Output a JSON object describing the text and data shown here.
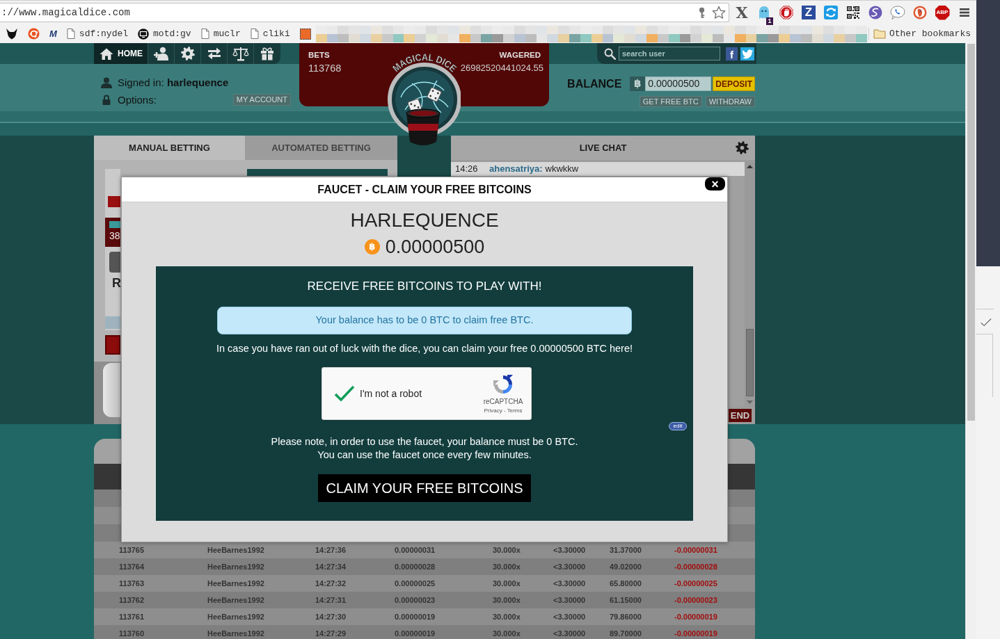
{
  "browser": {
    "address": "://www.magicaldice.com",
    "extensions": [
      {
        "kind": "letter",
        "label": "X"
      },
      {
        "kind": "ghost",
        "badge": "1"
      },
      {
        "kind": "stop"
      },
      {
        "kind": "tile",
        "label": "Z"
      },
      {
        "kind": "sync"
      },
      {
        "kind": "qr"
      },
      {
        "kind": "swirl"
      },
      {
        "kind": "phone"
      },
      {
        "kind": "duck"
      },
      {
        "kind": "octagon",
        "label": "ABP"
      }
    ],
    "bookmarks": [
      {
        "kind": "creature"
      },
      {
        "kind": "ring"
      },
      {
        "kind": "logo",
        "label": "M"
      },
      {
        "kind": "page",
        "label": "sdf:nydel"
      },
      {
        "kind": "disc",
        "label": "motd:gv"
      },
      {
        "kind": "page",
        "label": "muclr"
      },
      {
        "kind": "page",
        "label": "cliki"
      },
      {
        "kind": "square"
      }
    ],
    "other_bookmarks": "Other bookmarks"
  },
  "nav": {
    "items": [
      {
        "kind": "home",
        "label": "HOME",
        "selected": true
      },
      {
        "kind": "add-user",
        "selected": false
      },
      {
        "kind": "gear",
        "selected": false
      },
      {
        "kind": "exchange",
        "selected": false
      },
      {
        "kind": "scales",
        "selected": false
      },
      {
        "kind": "gift",
        "selected": false
      }
    ],
    "search": {
      "placeholder": "search user"
    },
    "social": [
      {
        "kind": "facebook",
        "label": "f"
      },
      {
        "kind": "twitter"
      }
    ]
  },
  "user": {
    "signed_in": "Signed in: **harlequence**",
    "options_label": "Options:",
    "account_button": "MY ACCOUNT"
  },
  "stats": {
    "bets_label": "BETS",
    "bets": "113768",
    "wagered_label": "WAGERED",
    "wagered": "26982520441024.55"
  },
  "logo": {
    "text": "MAGICAL DICE"
  },
  "balance": {
    "label": "BALANCE",
    "symbol": "฿",
    "value": "0.00000500",
    "deposit_button": "DEPOSIT",
    "buttons": [
      "GET FREE BTC",
      "WITHDRAW"
    ]
  },
  "betting_panel": {
    "tabs": [
      {
        "label": "MANUAL BETTING",
        "selected": true
      },
      {
        "label": "AUTOMATED BETTING",
        "selected": false
      }
    ],
    "box_value": "38",
    "letter": "R"
  },
  "chat": {
    "title": "LIVE CHAT",
    "messages": [
      {
        "time": "14:26",
        "user": "ahensatriya:",
        "text": "wkwkkw"
      }
    ],
    "send_button": "END"
  },
  "bets_table": {
    "rows": [
      {
        "id": "113765",
        "user": "HeeBarnes1992",
        "time": "14:27:36",
        "bet": "0.00000031",
        "payout": "30.000x",
        "target": "<3.30000",
        "roll": "31.37000",
        "profit": "-0.00000031"
      },
      {
        "id": "113764",
        "user": "HeeBarnes1992",
        "time": "14:27:34",
        "bet": "0.00000028",
        "payout": "30.000x",
        "target": "<3.30000",
        "roll": "49.02000",
        "profit": "-0.00000028"
      },
      {
        "id": "113763",
        "user": "HeeBarnes1992",
        "time": "14:27:32",
        "bet": "0.00000025",
        "payout": "30.000x",
        "target": "<3.30000",
        "roll": "65.80000",
        "profit": "-0.00000025"
      },
      {
        "id": "113762",
        "user": "HeeBarnes1992",
        "time": "14:27:31",
        "bet": "0.00000023",
        "payout": "30.000x",
        "target": "<3.30000",
        "roll": "61.15000",
        "profit": "-0.00000023"
      },
      {
        "id": "113761",
        "user": "HeeBarnes1992",
        "time": "14:27:30",
        "bet": "0.00000019",
        "payout": "30.000x",
        "target": "<3.30000",
        "roll": "79.86000",
        "profit": "-0.00000019"
      },
      {
        "id": "113760",
        "user": "HeeBarnes1992",
        "time": "14:27:29",
        "bet": "0.00000019",
        "payout": "30.000x",
        "target": "<3.30000",
        "roll": "89.70000",
        "profit": "-0.00000019"
      }
    ]
  },
  "faucet_modal": {
    "title": "FAUCET - CLAIM YOUR FREE BITCOINS",
    "close": "×",
    "username": "HARLEQUENCE",
    "coin_symbol": "฿",
    "balance": "0.00000500",
    "heading": "RECEIVE FREE BITCOINS TO PLAY WITH!",
    "alert": "Your balance has to be 0 BTC to claim free BTC.",
    "intro": "In case you have ran out of luck with the dice, you can claim your free 0.00000500 BTC here!",
    "captcha": {
      "checked": true,
      "label": "I'm not a robot",
      "brand": "reCAPTCHA",
      "links": "Privacy - Terms"
    },
    "edit": "edit",
    "notes": [
      "Please note, in order to use the faucet, your balance must be 0 BTC.",
      "You can use the faucet once every few minutes."
    ],
    "claim_button": "CLAIM YOUR FREE BITCOINS"
  }
}
